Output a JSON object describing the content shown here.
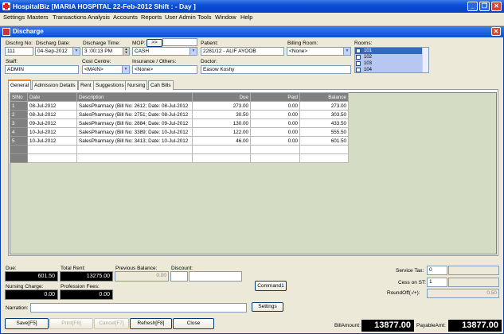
{
  "app": {
    "title": "HospitalBiz [MARIA HOSPITAL 22-Feb-2012  Shift : - Day ]"
  },
  "menu": [
    "Settings",
    "Masters",
    "Transactions",
    "Analysis",
    "Accounts",
    "Reports",
    "User Admin",
    "Tools",
    "Window",
    "Help"
  ],
  "form": {
    "title": "Discharge",
    "dischrg_no_label": "Dischrg No:",
    "dischrg_no": "111",
    "discharg_date_label": "Discharg Date:",
    "discharg_date": "04-Sep-2012",
    "discharge_time_label": "Discharge Time:",
    "discharge_time": "3 :00:13 PM",
    "mop_label": "MOP:",
    "mop_btn": ">>",
    "mop": "CASH",
    "patient_label": "Patient:",
    "patient": "2281/12 - ALIF AYOOB",
    "billing_room_label": "Billing Room:",
    "billing_room": "<None>",
    "rooms_label": "Rooms:",
    "rooms": [
      {
        "name": "101",
        "checked": "✓"
      },
      {
        "name": "102",
        "checked": ""
      },
      {
        "name": "103",
        "checked": ""
      },
      {
        "name": "104",
        "checked": ""
      }
    ],
    "staff_label": "Staff:",
    "staff": "ADMIN",
    "cost_centre_label": "Cost Centre:",
    "cost_centre": "<MAIN>",
    "insurance_label": "Insurance / Others:",
    "insurance": "<None>",
    "doctor_label": "Doctor:",
    "doctor": "Easow Koshy"
  },
  "tabs": [
    "General",
    "Admission Details",
    "Rent",
    "Suggestions",
    "Nursing",
    "Cah Bills"
  ],
  "grid": {
    "columns": [
      "SlNo",
      "Date",
      "Description",
      "Due",
      "Paid",
      "Balance"
    ],
    "rows": [
      {
        "slno": "1",
        "date": "08-Jul-2012",
        "desc": "SalesPharmacy (Bill No: 2612; Date: 08-Jul-2012",
        "due": "273.00",
        "paid": "0.00",
        "balance": "273.00"
      },
      {
        "slno": "2",
        "date": "08-Jul-2012",
        "desc": "SalesPharmacy (Bill No: 2751; Date: 08-Jul-2012",
        "due": "30.50",
        "paid": "0.00",
        "balance": "303.50"
      },
      {
        "slno": "3",
        "date": "09-Jul-2012",
        "desc": "SalesPharmacy (Bill No: 2884; Date: 09-Jul-2012",
        "due": "130.00",
        "paid": "0.00",
        "balance": "433.50"
      },
      {
        "slno": "4",
        "date": "10-Jul-2012",
        "desc": "SalesPharmacy (Bill No: 3389; Date: 10-Jul-2012",
        "due": "122.00",
        "paid": "0.00",
        "balance": "555.50"
      },
      {
        "slno": "5",
        "date": "10-Jul-2012",
        "desc": "SalesPharmacy (Bill No: 3413; Date: 10-Jul-2012",
        "due": "46.00",
        "paid": "0.00",
        "balance": "601.50"
      }
    ]
  },
  "totals": {
    "due_label": "Due:",
    "due": "601.50",
    "total_rent_label": "Total Rent:",
    "total_rent": "13275.00",
    "prev_balance_label": "Previous Balance:",
    "prev_balance": "0.00",
    "discount_label": "Discount:",
    "nursing_label": "Nursing Charge:",
    "nursing": "0.00",
    "profession_label": "Profession Fees:",
    "profession": "0.00",
    "command1": "Command1",
    "service_tax_label": "Service Tax:",
    "service_tax": "0",
    "cess_label": "Cess on ST:",
    "cess": "1",
    "roundoff_label": "RoundOff(-/+):",
    "roundoff": "0.50",
    "narration_label": "Narration:",
    "settings_btn": "Settings",
    "bill_amount_label": "BillAmount:",
    "bill_amount": "13877.00",
    "payable_label": "PayableAmt:",
    "payable": "13877.00"
  },
  "buttons": {
    "save": "Save[F5]",
    "print": "Print[F6]",
    "cancel": "Cancel[F7]",
    "refresh": "Refresh[F8]",
    "close": "Close"
  }
}
